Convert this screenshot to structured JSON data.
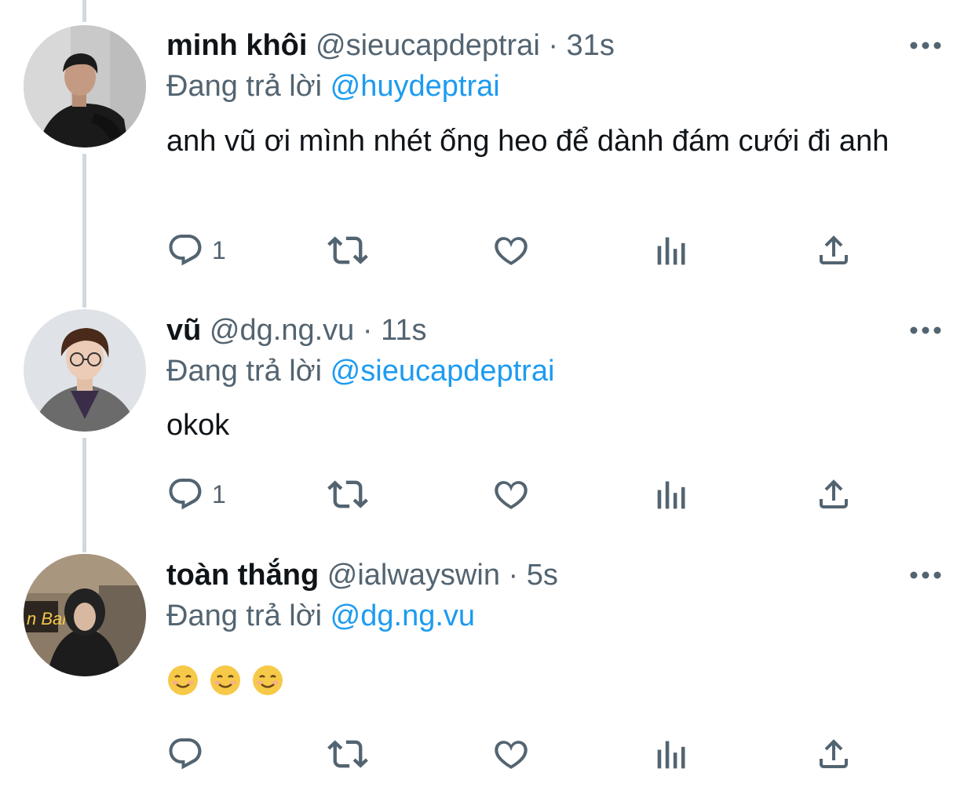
{
  "thread": {
    "replying_label": "Đang trả lời",
    "colors": {
      "text": "#0f1419",
      "secondary": "#536471",
      "link": "#1d9bf0",
      "thread_line": "#cfd9de"
    }
  },
  "tweets": [
    {
      "name": "minh khôi",
      "handle": "@sieucapdeptrai",
      "separator": "·",
      "time": "31s",
      "replying_to": "@huydeptrai",
      "text": "anh vũ ơi mình nhét ống heo để dành đám cưới đi anh",
      "reply_count": "1",
      "avatar": "avatar-photo-man-black-shirt"
    },
    {
      "name": "vũ",
      "handle": "@dg.ng.vu",
      "separator": "·",
      "time": "11s",
      "replying_to": "@sieucapdeptrai",
      "text": "okok",
      "reply_count": "1",
      "avatar": "avatar-photo-man-glasses-coat"
    },
    {
      "name": "toàn thắng",
      "handle": "@ialwayswin",
      "separator": "·",
      "time": "5s",
      "replying_to": "@dg.ng.vu",
      "text": "",
      "emoji": [
        "☺️",
        "☺️",
        "☺️"
      ],
      "reply_count": "",
      "avatar": "avatar-photo-man-hoodie-bar",
      "avatar_sign": "n Bar"
    }
  ],
  "icons": {
    "reply": "reply-icon",
    "retweet": "retweet-icon",
    "like": "heart-icon",
    "views": "analytics-icon",
    "share": "share-icon",
    "more": "more-icon"
  }
}
